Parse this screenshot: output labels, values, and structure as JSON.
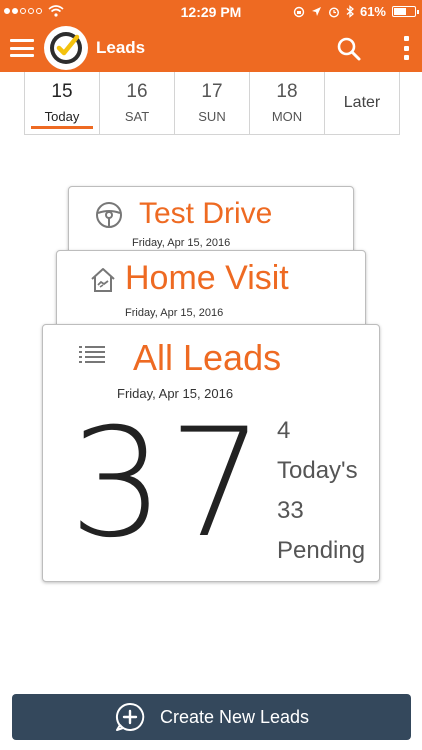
{
  "status_bar": {
    "time": "12:29 PM",
    "battery": "61%",
    "battery_level": 0.61,
    "icons": [
      "signal-dots-icon",
      "wifi-icon",
      "rotation-lock-icon",
      "location-arrow-icon",
      "alarm-icon",
      "bluetooth-icon",
      "battery-icon"
    ]
  },
  "header": {
    "title": "Leads",
    "icons": [
      "hamburger-menu-icon",
      "app-logo-check-icon",
      "search-icon",
      "more-vertical-icon"
    ]
  },
  "date_tabs": [
    {
      "num": "15",
      "day": "Today",
      "active": true
    },
    {
      "num": "16",
      "day": "SAT",
      "active": false
    },
    {
      "num": "17",
      "day": "SUN",
      "active": false
    },
    {
      "num": "18",
      "day": "MON",
      "active": false
    },
    {
      "label": "Later",
      "active": false
    }
  ],
  "cards": {
    "test_drive": {
      "title": "Test Drive",
      "date": "Friday, Apr 15, 2016",
      "icon": "steering-wheel-icon"
    },
    "home_visit": {
      "title": "Home Visit",
      "date": "Friday, Apr 15, 2016",
      "icon": "house-handshake-icon"
    },
    "all_leads": {
      "title": "All Leads",
      "date": "Friday, Apr 15, 2016",
      "icon": "list-icon",
      "count": "37",
      "today_count": "4",
      "today_label": "Today's",
      "pending_count": "33",
      "pending_label": "Pending"
    }
  },
  "create_button": {
    "label": "Create New Leads",
    "icon": "chat-plus-icon"
  },
  "colors": {
    "accent": "#ee6a22",
    "button": "#34485c",
    "text_dark": "#222222"
  }
}
